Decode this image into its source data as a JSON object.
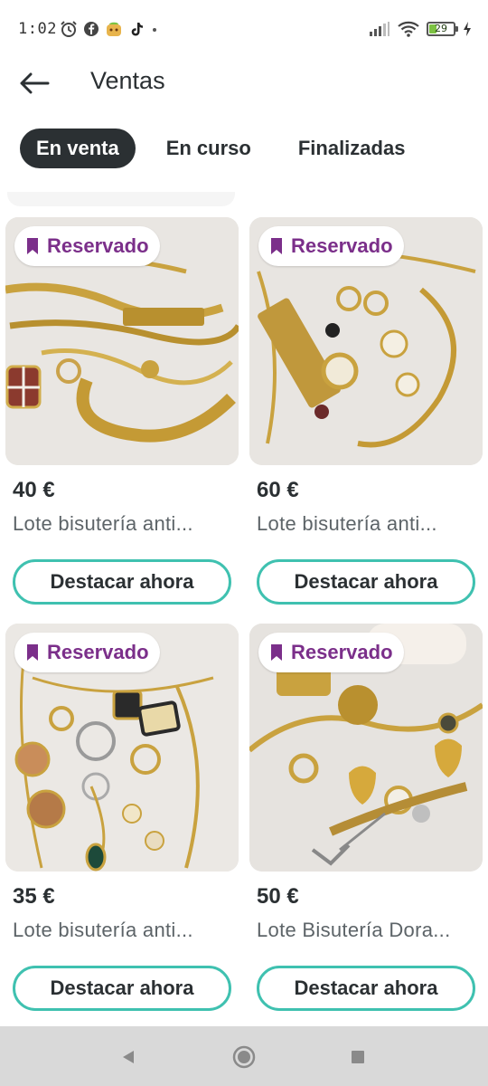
{
  "status_bar": {
    "time": "1:02",
    "battery_level": "29",
    "left_icons": [
      "alarm-icon",
      "facebook-icon",
      "app-icon",
      "tiktok-icon",
      "dot-icon"
    ],
    "right_icons": [
      "signal-icon",
      "wifi-icon",
      "battery-icon",
      "charging-icon"
    ]
  },
  "header": {
    "title": "Ventas",
    "back_icon": "arrow-left-icon"
  },
  "tabs": [
    {
      "label": "En venta",
      "active": true
    },
    {
      "label": "En curso",
      "active": false
    },
    {
      "label": "Finalizadas",
      "active": false
    }
  ],
  "items": [
    {
      "badge": "Reservado",
      "price": "40 €",
      "title": "Lote bisutería anti...",
      "button": "Destacar ahora"
    },
    {
      "badge": "Reservado",
      "price": "60 €",
      "title": "Lote bisutería anti...",
      "button": "Destacar ahora"
    },
    {
      "badge": "Reservado",
      "price": "35 €",
      "title": "Lote bisutería anti...",
      "button": "Destacar ahora"
    },
    {
      "badge": "Reservado",
      "price": "50 €",
      "title": "Lote Bisutería Dora...",
      "button": "Destacar ahora"
    }
  ],
  "colors": {
    "accent_teal": "#3fc1b0",
    "reserved_purple": "#7b2f8a",
    "dark_text": "#2b3033",
    "battery_green": "#7cc242"
  },
  "navbar": {
    "buttons": [
      "back-triangle-icon",
      "home-circle-icon",
      "recents-square-icon"
    ]
  }
}
